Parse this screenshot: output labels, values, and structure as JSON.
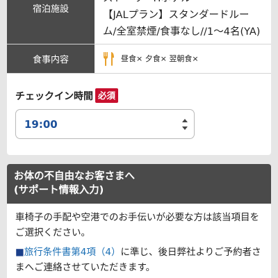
{
  "booking": {
    "hotel_label": "宿泊施設",
    "hotel_lines": [
      "ストーリーHホテル",
      "【JALプラン】スタンダードルー",
      "ム/全室禁煙/食事なし//1～4名(YA)"
    ],
    "meal_label": "食事内容",
    "meal_icon": "fork-knife-icon",
    "meal_text": "昼食× 夕食× 翌朝食×"
  },
  "checkin": {
    "title": "チェックイン時間",
    "required_badge": "必須",
    "selected_time": "19:00"
  },
  "support": {
    "header_line1": "お体の不自由なお客さまへ",
    "header_line2": "(サポート情報入力)",
    "body_text": "車椅子の手配や空港でのお手伝いが必要な方は該当項目をご選択ください。",
    "notice_mark": "■",
    "notice_link": "旅行条件書第4項（4）",
    "notice_rest": "に準じ、後日弊社よりご予約者さまへご連絡させていただきます。"
  },
  "colors": {
    "header_bg": "#4a4a4a",
    "required_red": "#c8102e",
    "time_blue": "#1a4f9a",
    "link_blue": "#1a6fb5",
    "meal_icon_orange": "#e8a02a"
  }
}
